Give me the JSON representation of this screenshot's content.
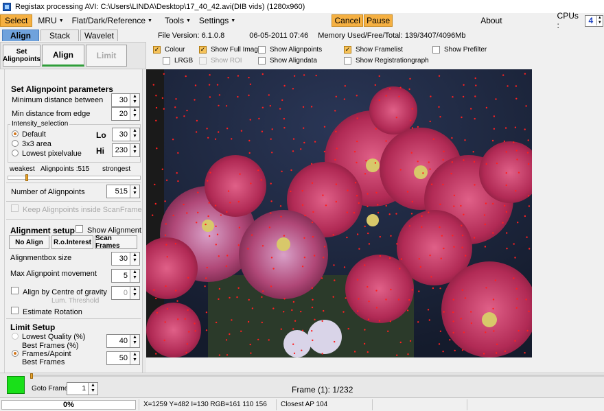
{
  "titlebar": {
    "title": "Registax processing AVI: C:\\Users\\LINDA\\Desktop\\17_40_42.avi(DIB vids) (1280x960)"
  },
  "menubar": {
    "select": "Select",
    "mru": "MRU",
    "flat": "Flat/Dark/Reference",
    "tools": "Tools",
    "settings": "Settings",
    "cancel": "Cancel",
    "pause": "Pause",
    "about": "About",
    "cpus_label": "CPUs :",
    "cpus_value": "4"
  },
  "tabs": {
    "align": "Align",
    "stack": "Stack",
    "wavelet": "Wavelet",
    "file_version": "File Version: 6.1.0.8",
    "date": "06-05-2011 07:46",
    "memory": "Memory Used/Free/Total: 139/3407/4096Mb"
  },
  "align_buttons": {
    "set_alignpoints_1": "Set",
    "set_alignpoints_2": "Alignpoints",
    "align": "Align",
    "limit": "Limit"
  },
  "options": {
    "colour": "Colour",
    "show_full_image": "Show Full Image",
    "show_alignpoints": "Show Alignpoints",
    "show_framelist": "Show Framelist",
    "show_prefilter": "Show Prefilter",
    "lrgb": "LRGB",
    "show_roi": "Show ROI",
    "show_aligndata": "Show Aligndata",
    "show_registrationgraph": "Show Registrationgraph"
  },
  "panel": {
    "set_params_title": "Set Alignpoint parameters",
    "min_distance_between": "Minimum distance between",
    "min_distance_between_value": "30",
    "min_distance_edge": "Min distance from edge",
    "min_distance_edge_value": "20",
    "intensity_selection": "Intensity_selection",
    "default": "Default",
    "area_3x3": "3x3 area",
    "lowest_pixelvalue": "Lowest pixelvalue",
    "lo_label": "Lo",
    "lo_value": "30",
    "hi_label": "Hi",
    "hi_value": "230",
    "weakest": "weakest",
    "alignpoints_count": "Alignpoints :515",
    "strongest": "strongest",
    "number_of_alignpoints": "Number of Alignpoints",
    "number_of_alignpoints_value": "515",
    "keep_inside_scanframe": "Keep Alignpoints inside ScanFrame",
    "alignment_setup": "Alignment setup",
    "show_alignment": "Show Alignment",
    "no_align": "No Align",
    "ro_interest": "R.o.Interest",
    "scan_frames": "Scan Frames",
    "alignmentbox_size": "Alignmentbox size",
    "alignmentbox_size_value": "30",
    "max_alignpoint_movement": "Max Alignpoint movement",
    "max_alignpoint_movement_value": "5",
    "align_by_centre": "Align by Centre of gravity",
    "lum_threshold": "Lum. Threshold",
    "lum_threshold_value": "0",
    "estimate_rotation": "Estimate Rotation",
    "limit_setup": "Limit Setup",
    "lowest_quality": "Lowest Quality (%)",
    "best_frames_pct": "Best Frames (%)",
    "frames_apoint": "Frames/Apoint",
    "best_frames": "Best Frames",
    "limit_value_1": "40",
    "limit_value_2": "50"
  },
  "bottom": {
    "goto_frame": "Goto Frame",
    "goto_value": "1",
    "frame_info": "Frame (1): 1/232"
  },
  "status": {
    "progress": "0%",
    "progress_fraction": 0,
    "pixel_info": "X=1259 Y=482 I=130 RGB=161 110 156",
    "closest_ap": "Closest AP 104"
  },
  "colors": {
    "accent_orange": "#f5b042",
    "tab_blue": "#6fa2dc",
    "status_green": "#19e019",
    "alignpoint_red": "#ff2020"
  }
}
